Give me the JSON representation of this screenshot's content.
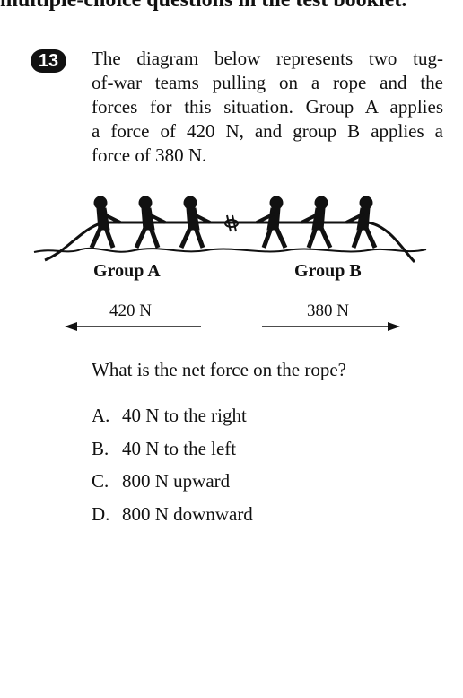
{
  "header": {
    "cut_text": "multiple-choice questions in the test booklet."
  },
  "question": {
    "number": "13",
    "stem_lines": [
      "The diagram below represents two tug-",
      "of-war teams pulling on a rope and the",
      "forces for this situation. Group A applies",
      "a force of 420 N, and group B applies a",
      "force of 380 N."
    ],
    "prompt": "What is the net force on the rope?",
    "choices": [
      {
        "letter": "A.",
        "text": "40 N to the right"
      },
      {
        "letter": "B.",
        "text": "40 N to the left"
      },
      {
        "letter": "C.",
        "text": "800 N upward"
      },
      {
        "letter": "D.",
        "text": "800 N downward"
      }
    ]
  },
  "diagram": {
    "group_a": {
      "label": "Group A",
      "force": "420 N",
      "direction": "left"
    },
    "group_b": {
      "label": "Group B",
      "force": "380 N",
      "direction": "right"
    }
  }
}
